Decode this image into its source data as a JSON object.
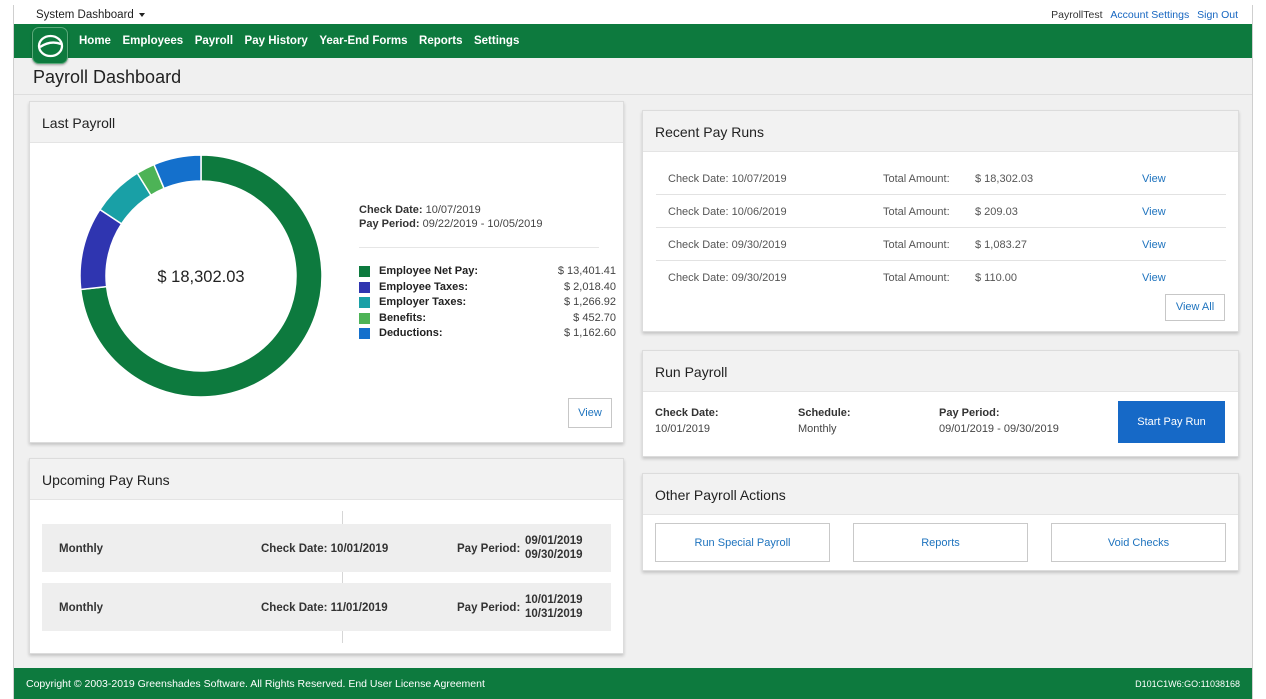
{
  "topbar": {
    "system_dashboard": "System Dashboard",
    "user": "PayrollTest",
    "account_settings": "Account Settings",
    "sign_out": "Sign Out"
  },
  "nav": {
    "items": [
      "Home",
      "Employees",
      "Payroll",
      "Pay History",
      "Year-End Forms",
      "Reports",
      "Settings"
    ]
  },
  "page_title": "Payroll Dashboard",
  "last_payroll": {
    "title": "Last Payroll",
    "total": "$ 18,302.03",
    "check_date_label": "Check Date:",
    "check_date": "10/07/2019",
    "pay_period_label": "Pay Period:",
    "pay_period": "09/22/2019 - 10/05/2019",
    "legend": [
      {
        "label": "Employee Net Pay:",
        "value": "$ 13,401.41",
        "amount": 13401.41,
        "color": "#0d7a3e"
      },
      {
        "label": "Employee Taxes:",
        "value": "$ 2,018.40",
        "amount": 2018.4,
        "color": "#2f35b0"
      },
      {
        "label": "Employer Taxes:",
        "value": "$ 1,266.92",
        "amount": 1266.92,
        "color": "#19a0a6"
      },
      {
        "label": "Benefits:",
        "value": "$ 452.70",
        "amount": 452.7,
        "color": "#4db356"
      },
      {
        "label": "Deductions:",
        "value": "$ 1,162.60",
        "amount": 1162.6,
        "color": "#1470cc"
      }
    ],
    "view_label": "View"
  },
  "upcoming": {
    "title": "Upcoming Pay Runs",
    "rows": [
      {
        "frequency": "Monthly",
        "check_date": "Check Date: 10/01/2019",
        "pay_period_label": "Pay Period:",
        "start": "09/01/2019",
        "end": "09/30/2019"
      },
      {
        "frequency": "Monthly",
        "check_date": "Check Date: 11/01/2019",
        "pay_period_label": "Pay Period:",
        "start": "10/01/2019",
        "end": "10/31/2019"
      }
    ]
  },
  "recent": {
    "title": "Recent Pay Runs",
    "rows": [
      {
        "check_date": "Check Date: 10/07/2019",
        "total_label": "Total Amount:",
        "amount": "$ 18,302.03",
        "view": "View"
      },
      {
        "check_date": "Check Date: 10/06/2019",
        "total_label": "Total Amount:",
        "amount": "$ 209.03",
        "view": "View"
      },
      {
        "check_date": "Check Date: 09/30/2019",
        "total_label": "Total Amount:",
        "amount": "$ 1,083.27",
        "view": "View"
      },
      {
        "check_date": "Check Date: 09/30/2019",
        "total_label": "Total Amount:",
        "amount": "$ 110.00",
        "view": "View"
      }
    ],
    "view_all": "View All"
  },
  "run_payroll": {
    "title": "Run Payroll",
    "check_date_label": "Check Date:",
    "check_date": "10/01/2019",
    "schedule_label": "Schedule:",
    "schedule": "Monthly",
    "pay_period_label": "Pay Period:",
    "pay_period": "09/01/2019 - 09/30/2019",
    "start_button": "Start Pay Run"
  },
  "other_actions": {
    "title": "Other Payroll Actions",
    "buttons": [
      "Run Special Payroll",
      "Reports",
      "Void Checks"
    ]
  },
  "footer": {
    "copyright": "Copyright © 2003-2019 Greenshades Software. All Rights Reserved. End User License Agreement",
    "build": "D101C1W6:GO:11038168"
  },
  "colors": {
    "brand_green": "#0d7a3e",
    "primary_blue": "#1669c7",
    "link_blue": "#1e73be"
  }
}
